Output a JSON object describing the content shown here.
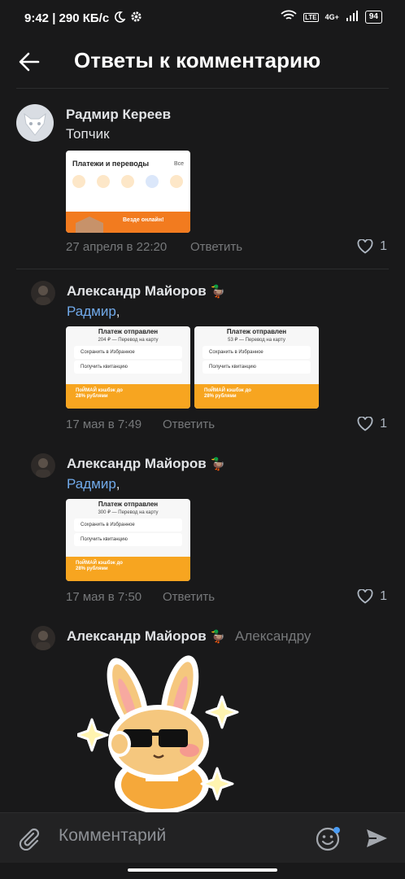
{
  "status": {
    "time": "9:42 | 290 КБ/с",
    "network": "4G+",
    "battery": "94"
  },
  "header": {
    "title": "Ответы к комментарию"
  },
  "comments": [
    {
      "author": "Радмир Кереев",
      "text": "Топчик",
      "date": "27 апреля в 22:20",
      "reply": "Ответить",
      "likes": "1",
      "image": {
        "title": "Платежи и переводы",
        "all": "Все",
        "banner": "Везде онлайн!"
      }
    },
    {
      "author": "Александр Майоров",
      "emoji": "🦆",
      "mention": "Радмир",
      "date": "17 мая в 7:49",
      "reply": "Ответить",
      "likes": "1",
      "images": [
        {
          "title": "Платеж отправлен",
          "sub": "204 ₽ — Перевод на карту",
          "row1": "Сохранить в Избранное",
          "row2": "Получить квитанцию",
          "promo": "ПоЙМАЙ кэшбэк до 28% рублями"
        },
        {
          "title": "Платеж отправлен",
          "sub": "53 ₽ — Перевод на карту",
          "row1": "Сохранить в Избранное",
          "row2": "Получить квитанцию",
          "promo": "ПоЙМАЙ кэшбэк до 28% рублями"
        }
      ]
    },
    {
      "author": "Александр Майоров",
      "emoji": "🦆",
      "mention": "Радмир",
      "date": "17 мая в 7:50",
      "reply": "Ответить",
      "likes": "1",
      "image": {
        "title": "Платеж отправлен",
        "sub": "300 ₽ — Перевод на карту",
        "row1": "Сохранить в Избранное",
        "row2": "Получить квитанцию",
        "promo": "ПоЙМАЙ кэшбэк до 28% рублями"
      }
    },
    {
      "author": "Александр Майоров",
      "emoji": "🦆",
      "reply_to": "Александру"
    }
  ],
  "composer": {
    "placeholder": "Комментарий"
  }
}
